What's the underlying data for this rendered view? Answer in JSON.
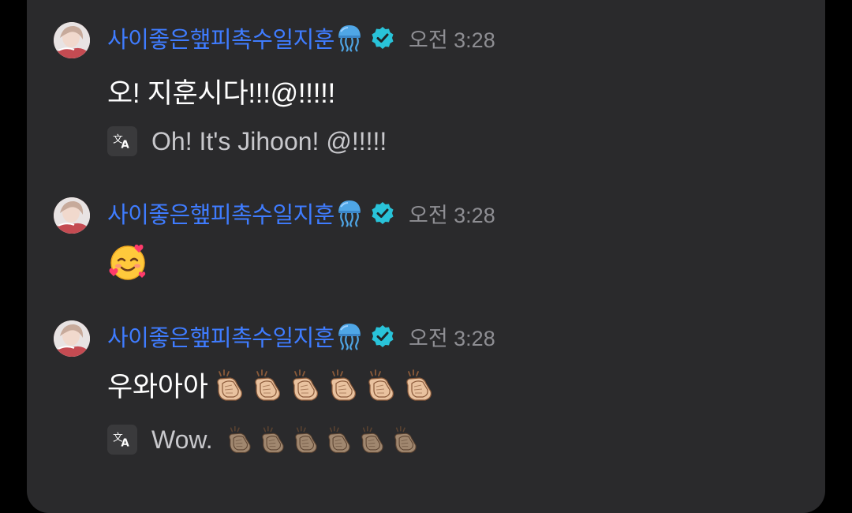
{
  "messages": [
    {
      "username": "사이좋은햎피촉수일지훈",
      "time": "오전 3:28",
      "text": "오! 지훈시다!!!@!!!!!",
      "translation": "Oh! It's Jihoon! @!!!!!"
    },
    {
      "username": "사이좋은햎피촉수일지훈",
      "time": "오전 3:28",
      "text": "",
      "emoji": "smiling-face-with-hearts"
    },
    {
      "username": "사이좋은햎피촉수일지훈",
      "time": "오전 3:28",
      "text": "우와아아",
      "clap_count": 6,
      "translation": "Wow.",
      "translation_clap_count": 6
    }
  ],
  "colors": {
    "panel": "#2a2a2c",
    "username": "#3f7cff",
    "verified": "#29c3d9",
    "time": "#8e8e93",
    "text": "#ffffff",
    "translation": "#c8c8cc"
  },
  "icons": {
    "jelly": "jellyfish-icon",
    "verified": "verified-badge-icon",
    "translate": "translate-icon",
    "clap": "clapping-hands-icon"
  }
}
